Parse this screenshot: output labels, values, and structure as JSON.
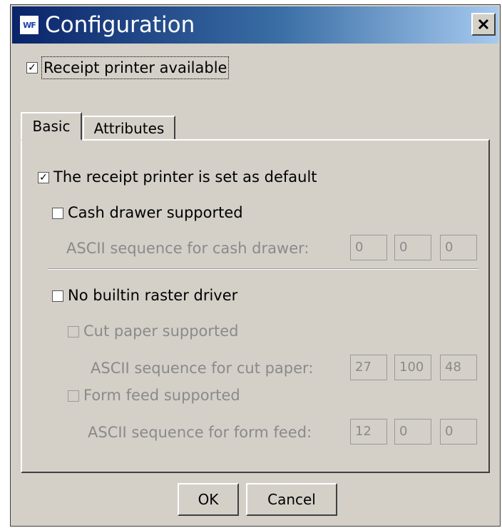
{
  "window": {
    "title": "Configuration",
    "icon_text": "WF",
    "close_label": "✕"
  },
  "receipt_printer": {
    "label": "Receipt printer available",
    "checked": true
  },
  "tabs": [
    {
      "label": "Basic",
      "active": true
    },
    {
      "label": "Attributes",
      "active": false
    }
  ],
  "basic": {
    "default_printer": {
      "label": "The receipt printer is set as default",
      "checked": true
    },
    "cash_drawer": {
      "label": "Cash drawer supported",
      "checked": false,
      "sequence_label": "ASCII sequence for cash drawer:",
      "values": [
        "0",
        "0",
        "0"
      ]
    },
    "no_raster": {
      "label": "No builtin raster driver",
      "checked": false
    },
    "cut_paper": {
      "label": "Cut paper supported",
      "checked": false,
      "sequence_label": "ASCII sequence for cut paper:",
      "values": [
        "27",
        "100",
        "48"
      ]
    },
    "form_feed": {
      "label": "Form feed supported",
      "checked": false,
      "sequence_label": "ASCII sequence for form feed:",
      "values": [
        "12",
        "0",
        "0"
      ]
    }
  },
  "buttons": {
    "ok": "OK",
    "cancel": "Cancel"
  }
}
